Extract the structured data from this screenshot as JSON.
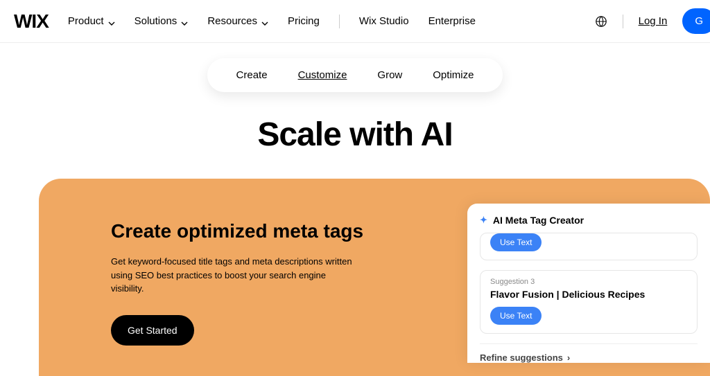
{
  "header": {
    "logo": "WIX",
    "nav": [
      {
        "label": "Product",
        "dropdown": true
      },
      {
        "label": "Solutions",
        "dropdown": true
      },
      {
        "label": "Resources",
        "dropdown": true
      },
      {
        "label": "Pricing",
        "dropdown": false
      }
    ],
    "secondary": [
      "Wix Studio",
      "Enterprise"
    ],
    "login": "Log In",
    "cta": "G"
  },
  "tabs": [
    "Create",
    "Customize",
    "Grow",
    "Optimize"
  ],
  "tabs_active_index": 1,
  "hero_title": "Scale with AI",
  "feature": {
    "title": "Create optimized meta tags",
    "desc": "Get keyword-focused title tags and meta descriptions written using SEO best practices to boost your search engine visibility.",
    "cta": "Get Started"
  },
  "ai_card": {
    "title": "AI Meta Tag Creator",
    "use_text": "Use Text",
    "suggestion_label": "Suggestion 3",
    "suggestion_text": "Flavor Fusion | Delicious Recipes",
    "refine": "Refine suggestions"
  }
}
